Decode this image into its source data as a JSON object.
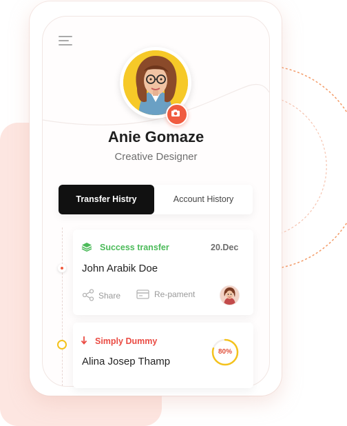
{
  "profile": {
    "name": "Anie Gomaze",
    "role": "Creative Designer"
  },
  "tabs": [
    {
      "label": "Transfer Histry",
      "active": true
    },
    {
      "label": "Account History",
      "active": false
    }
  ],
  "transactions": [
    {
      "status": "Success transfer",
      "status_color": "#4cbb5a",
      "date": "20.Dec",
      "person": "John Arabik Doe",
      "actions": [
        "Share",
        "Re-pament"
      ]
    },
    {
      "status": "Simply Dummy",
      "status_color": "#ea4b43",
      "person": "Alina Josep Thamp",
      "progress": 80,
      "progress_label": "80%"
    }
  ],
  "colors": {
    "accent": "#f05b3f",
    "tab_active": "#111111",
    "progress": "#f4c21c",
    "success": "#4cbb5a",
    "danger": "#ea4b43"
  },
  "icons": {
    "menu": "hamburger-icon",
    "camera": "camera-icon",
    "success": "stack-icon",
    "danger": "arrow-down-icon",
    "share": "share-icon",
    "repayment": "card-icon"
  }
}
